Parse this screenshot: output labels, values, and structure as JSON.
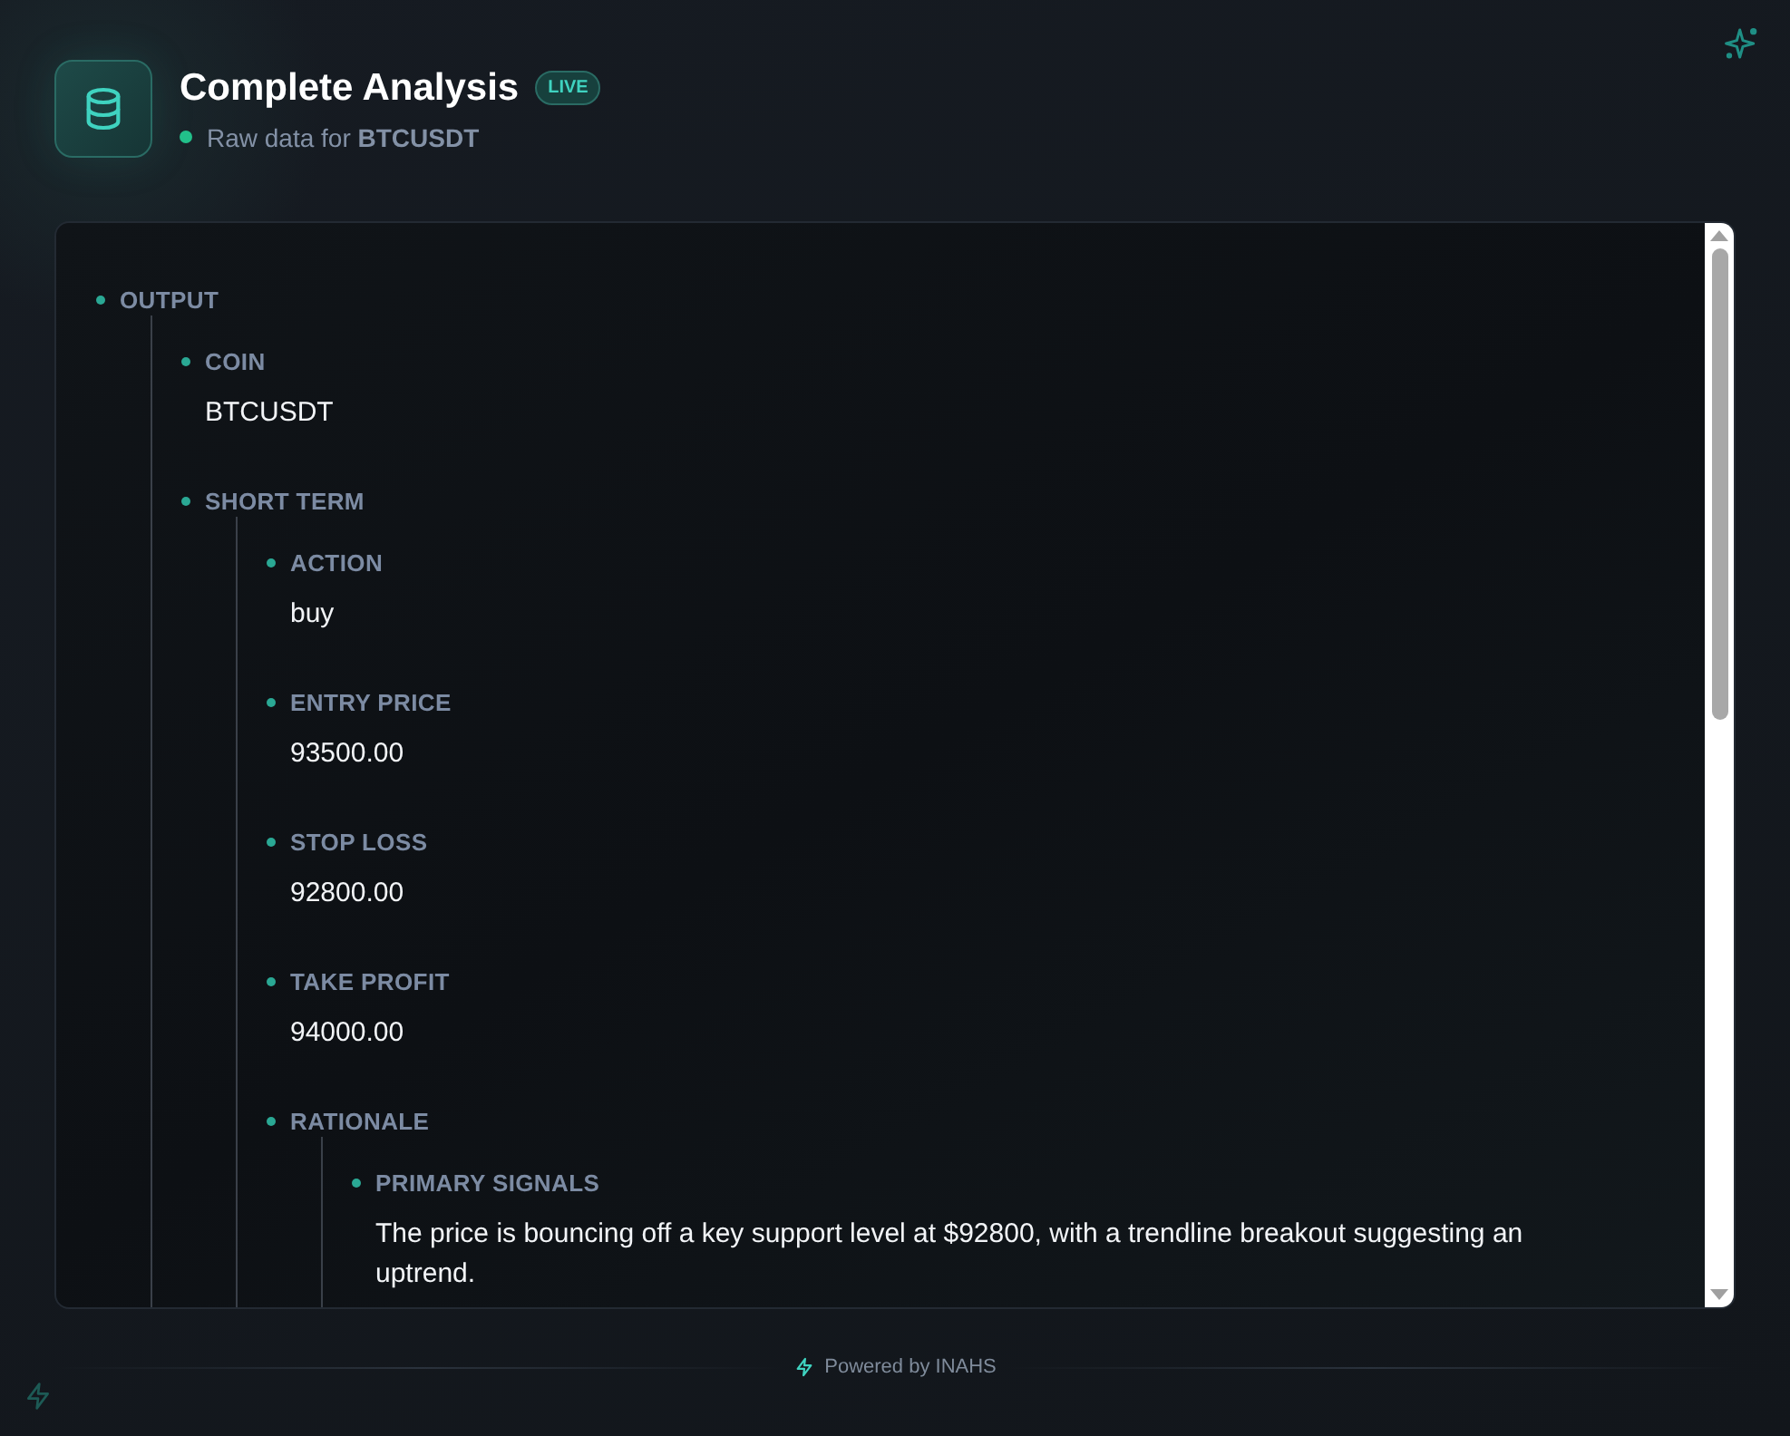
{
  "header": {
    "title": "Complete Analysis",
    "badge": "LIVE",
    "subtitle": "Raw data for **BTCUSDT**"
  },
  "tree": [
    {
      "label": "OUTPUT",
      "children": [
        {
          "label": "COIN",
          "value": "BTCUSDT"
        },
        {
          "label": "SHORT TERM",
          "children": [
            {
              "label": "ACTION",
              "value": "buy"
            },
            {
              "label": "ENTRY PRICE",
              "value": "93500.00"
            },
            {
              "label": "STOP LOSS",
              "value": "92800.00"
            },
            {
              "label": "TAKE PROFIT",
              "value": "94000.00"
            },
            {
              "label": "RATIONALE",
              "children": [
                {
                  "label": "PRIMARY SIGNALS",
                  "value": "The price is bouncing off a key support level at $92800, with a trendline breakout suggesting an uptrend."
                }
              ]
            }
          ]
        }
      ]
    }
  ],
  "footer": {
    "text": "Powered by INAHS"
  }
}
